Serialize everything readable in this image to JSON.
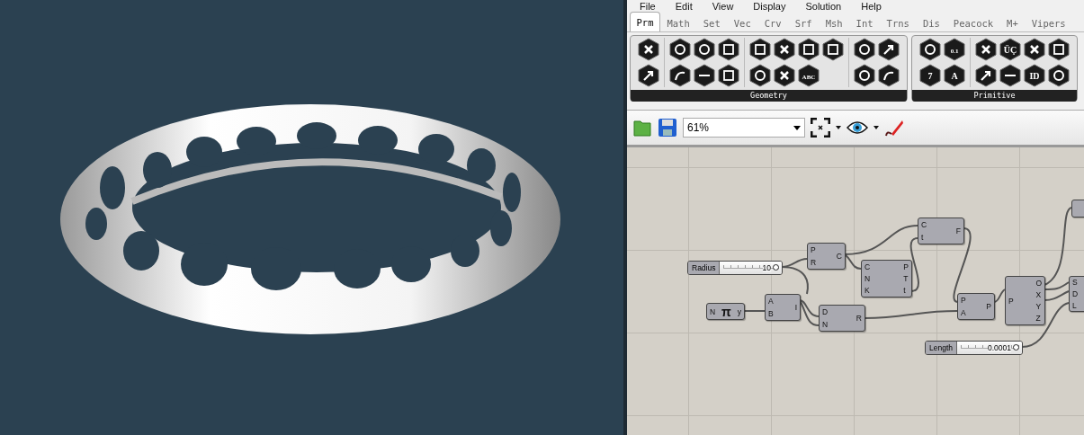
{
  "menu": [
    "File",
    "Edit",
    "View",
    "Display",
    "Solution",
    "Help"
  ],
  "tabs": [
    {
      "label": "Prm",
      "selected": true
    },
    {
      "label": "Math",
      "selected": false
    },
    {
      "label": "Set",
      "selected": false
    },
    {
      "label": "Vec",
      "selected": false
    },
    {
      "label": "Crv",
      "selected": false
    },
    {
      "label": "Srf",
      "selected": false
    },
    {
      "label": "Msh",
      "selected": false
    },
    {
      "label": "Int",
      "selected": false
    },
    {
      "label": "Trns",
      "selected": false
    },
    {
      "label": "Dis",
      "selected": false
    },
    {
      "label": "Peacock",
      "selected": false
    },
    {
      "label": "M+",
      "selected": false
    },
    {
      "label": "Vipers",
      "selected": false
    }
  ],
  "ribbon_groups": [
    {
      "title": "Geometry",
      "sections": [
        {
          "top": [
            {
              "kind": "cross"
            }
          ],
          "bottom": [
            {
              "kind": "arrow"
            }
          ]
        },
        {
          "top": [
            {
              "kind": "ring"
            },
            {
              "kind": "ring"
            },
            {
              "kind": "square"
            }
          ],
          "bottom": [
            {
              "kind": "curve"
            },
            {
              "kind": "line"
            },
            {
              "kind": "square"
            }
          ]
        },
        {
          "top": [
            {
              "kind": "square"
            },
            {
              "kind": "cross"
            },
            {
              "kind": "square"
            },
            {
              "kind": "square"
            }
          ],
          "bottom": [
            {
              "kind": "ring"
            },
            {
              "kind": "cross"
            },
            {
              "kind": "text",
              "text": "ABC"
            }
          ]
        },
        {
          "top": [
            {
              "kind": "ring"
            },
            {
              "kind": "arrow"
            }
          ],
          "bottom": [
            {
              "kind": "ring"
            },
            {
              "kind": "curve"
            }
          ]
        }
      ]
    },
    {
      "title": "Primitive",
      "sections": [
        {
          "top": [
            {
              "kind": "ring"
            },
            {
              "kind": "text",
              "text": "0.1"
            }
          ],
          "bottom": [
            {
              "kind": "text",
              "text": "7"
            },
            {
              "kind": "text",
              "text": "A"
            }
          ]
        },
        {
          "top": [
            {
              "kind": "cross"
            },
            {
              "kind": "text",
              "text": "ÜÇ"
            },
            {
              "kind": "cross"
            },
            {
              "kind": "square"
            }
          ],
          "bottom": [
            {
              "kind": "arrow"
            },
            {
              "kind": "line"
            },
            {
              "kind": "text",
              "text": "ID"
            },
            {
              "kind": "ring"
            }
          ]
        }
      ]
    }
  ],
  "toolbar": {
    "zoom": "61%"
  },
  "nodes": [
    {
      "kind": "slider",
      "label": "Radius",
      "value": "10",
      "level": 1
    },
    {
      "kind": "component",
      "inputs": [
        "P",
        "R"
      ],
      "outputs": [
        "C"
      ]
    },
    {
      "kind": "component",
      "inputs": [
        "C",
        "t"
      ],
      "outputs": [
        "F"
      ]
    },
    {
      "kind": "component",
      "inputs": [
        "C",
        "N",
        "K"
      ],
      "outputs": [
        "P",
        "T",
        "t"
      ]
    },
    {
      "kind": "component",
      "inputs": [
        "N"
      ],
      "outputs": [
        "y"
      ],
      "symbol": "π"
    },
    {
      "kind": "component",
      "inputs": [
        "A",
        "B"
      ],
      "outputs": [
        "I"
      ]
    },
    {
      "kind": "component",
      "inputs": [
        "D",
        "N"
      ],
      "outputs": [
        "R"
      ]
    },
    {
      "kind": "component",
      "inputs": [
        "P",
        "A"
      ],
      "outputs": [
        "P"
      ]
    },
    {
      "kind": "component",
      "inputs": [
        "P"
      ],
      "outputs": [
        "O",
        "X",
        "Y",
        "Z"
      ]
    },
    {
      "kind": "component",
      "inputs": [
        "S",
        "D",
        "L"
      ]
    },
    {
      "kind": "slider",
      "label": "Length",
      "value": "0.0001",
      "level": 1
    },
    {
      "kind": "component"
    }
  ]
}
